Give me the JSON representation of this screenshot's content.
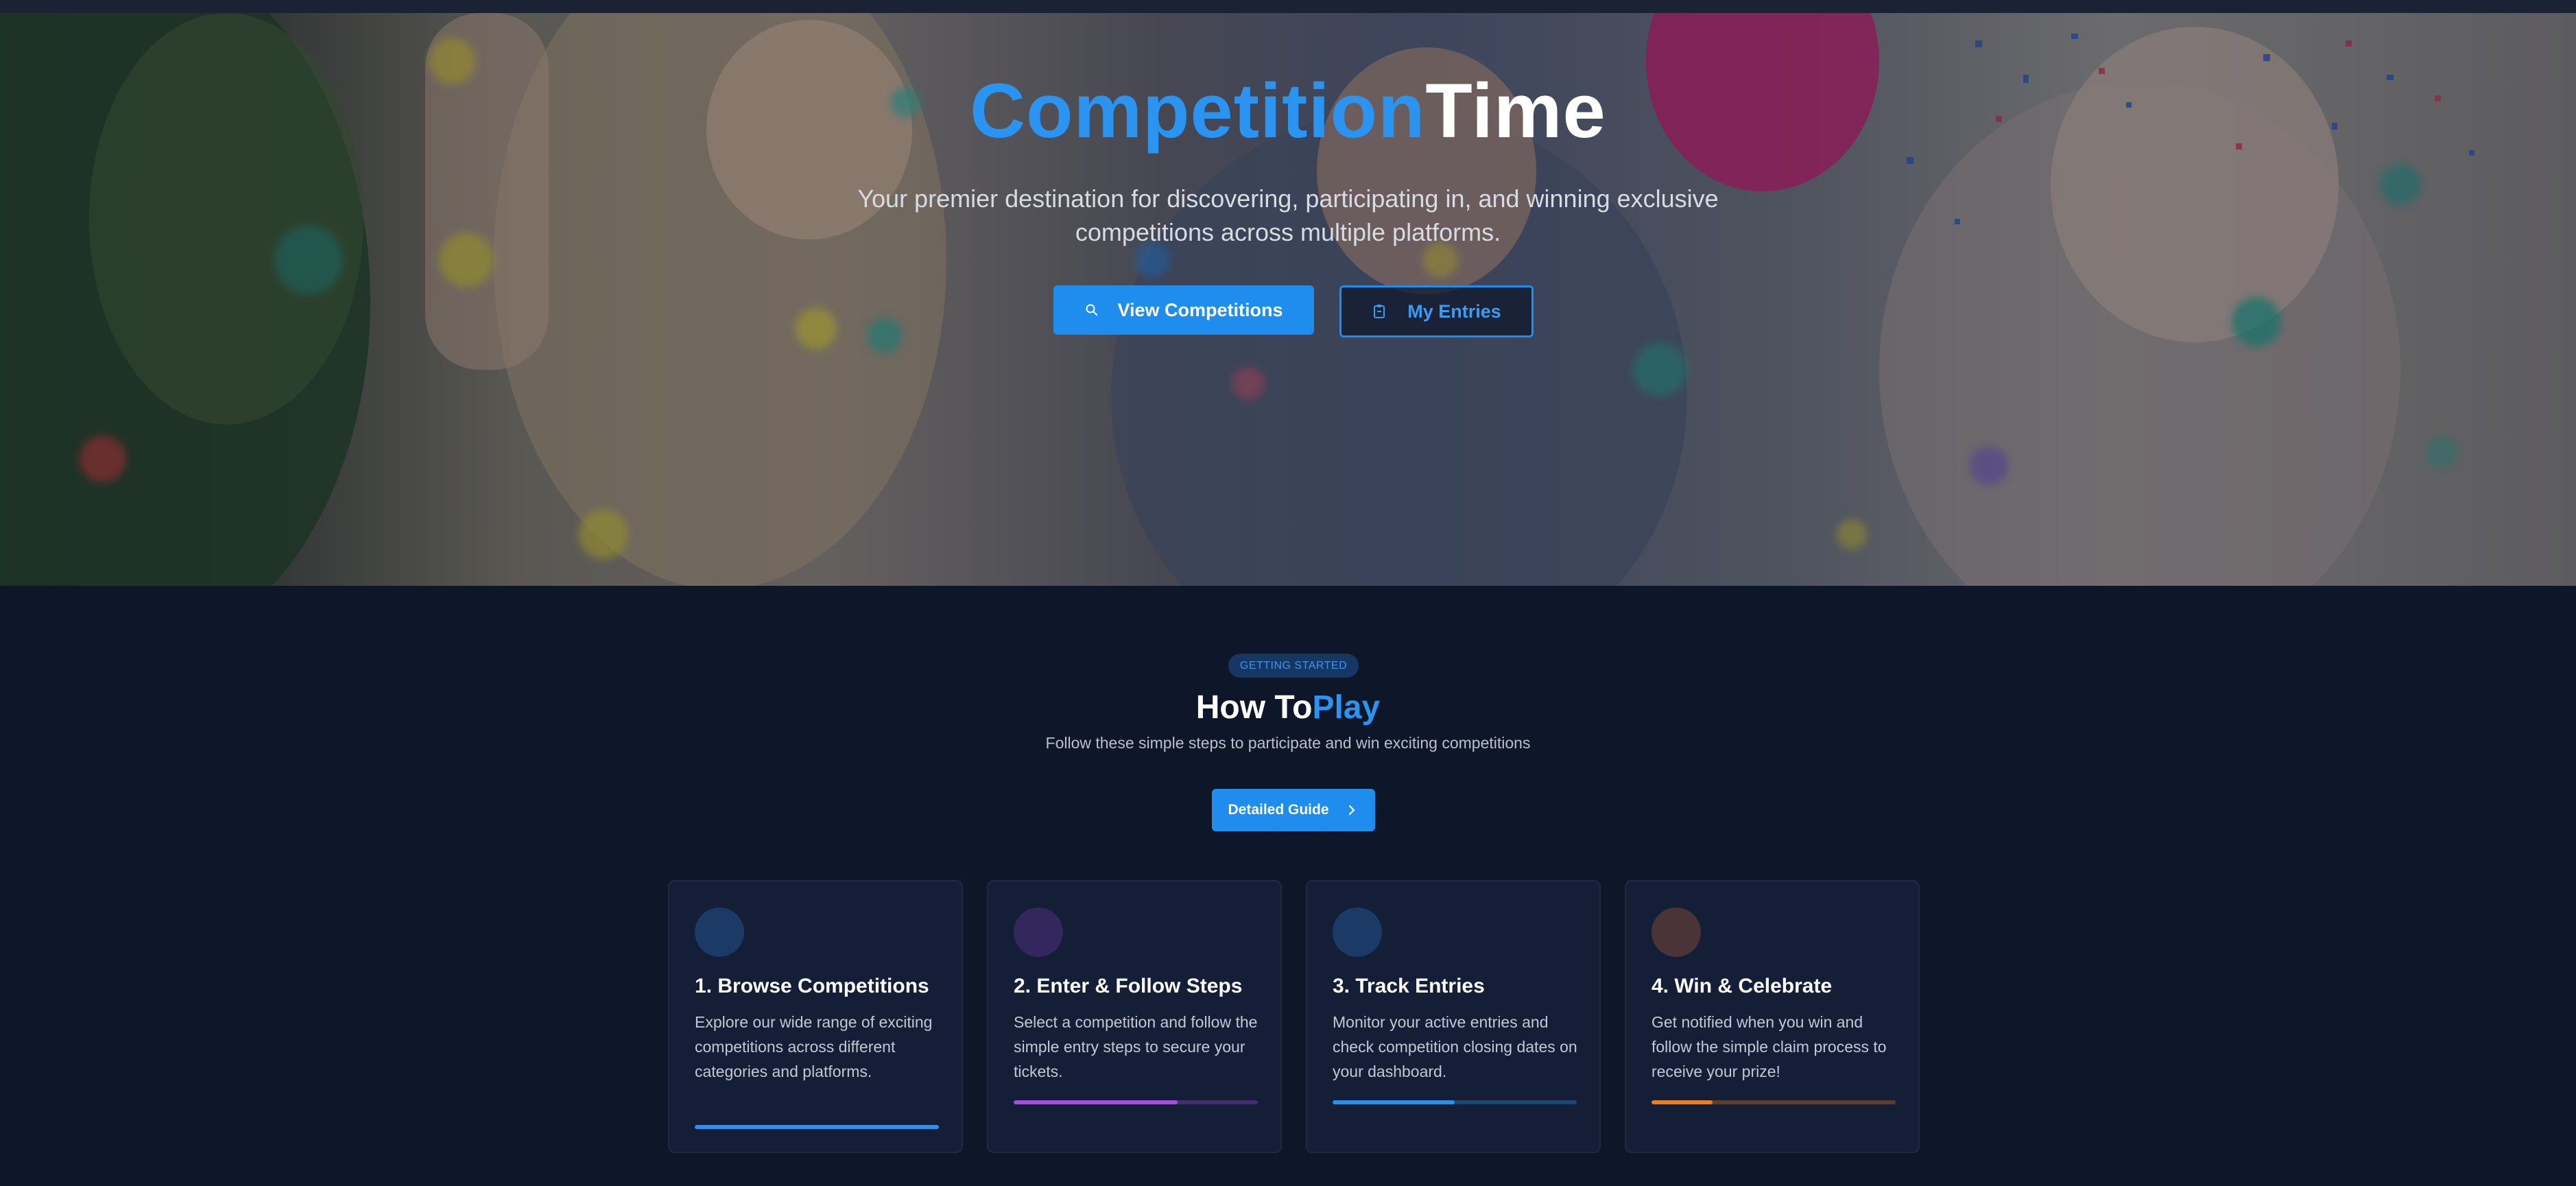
{
  "hero": {
    "title_part1": "Competition",
    "title_part2": "Time",
    "subtitle": "Your premier destination for discovering, participating in, and winning exclusive competitions across multiple platforms.",
    "primary_button": {
      "label": "View Competitions",
      "icon": "search-icon"
    },
    "secondary_button": {
      "label": "My Entries",
      "icon": "clipboard-icon"
    }
  },
  "how_to": {
    "badge": "GETTING STARTED",
    "title_part1": "How To",
    "title_part2": "Play",
    "subtitle": "Follow these simple steps to participate and win exciting competitions",
    "guide_button": {
      "label": "Detailed Guide",
      "icon": "chevron-right-icon"
    },
    "steps": [
      {
        "title": "1. Browse Competitions",
        "description": "Explore our wide range of exciting competitions across different categories and platforms.",
        "progress": 1.0,
        "color": "#2b8fef",
        "circle_color": "#1b3a66"
      },
      {
        "title": "2. Enter & Follow Steps",
        "description": "Select a competition and follow the simple entry steps to secure your tickets.",
        "progress": 0.67,
        "color": "#a54ee6",
        "circle_color": "#33285e"
      },
      {
        "title": "3. Track Entries",
        "description": "Monitor your active entries and check competition closing dates on your dashboard.",
        "progress": 0.5,
        "color": "#2b8fef",
        "circle_color": "#1b3a66"
      },
      {
        "title": "4. Win & Celebrate",
        "description": "Get notified when you win and follow the simple claim process to receive your prize!",
        "progress": 0.25,
        "color": "#f07b22",
        "circle_color": "#4a3437"
      }
    ]
  }
}
